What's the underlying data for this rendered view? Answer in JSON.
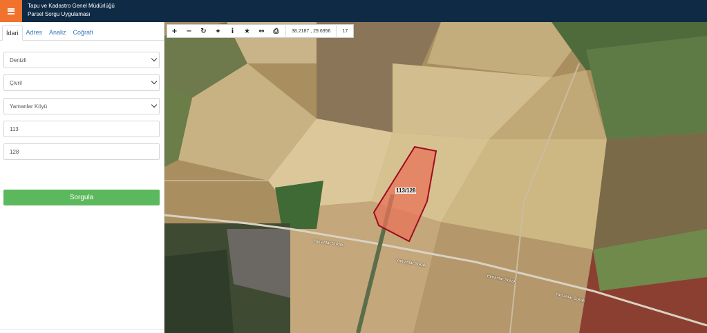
{
  "header": {
    "title_line1": "Tapu ve Kadastro Genel Müdürlüğü",
    "title_line2": "Parsel Sorgu Uygulaması",
    "menu_icon": "hamburger-icon",
    "accent": "#f0722d",
    "background": "#0f2a44"
  },
  "sidebar": {
    "tabs": [
      {
        "label": "İdari",
        "active": true
      },
      {
        "label": "Adres",
        "active": false
      },
      {
        "label": "Analiz",
        "active": false
      },
      {
        "label": "Coğrafi",
        "active": false
      }
    ],
    "province": "Denizli",
    "district": "Çivril",
    "neighborhood": "Yamanlar Köyü",
    "block": "113",
    "parcel": "128",
    "query_button": "Sorgula",
    "query_color": "#5cb85c"
  },
  "toolbar": {
    "tools": [
      "plus-icon",
      "minus-icon",
      "refresh-icon",
      "crosshair-icon",
      "info-icon",
      "star-icon",
      "measure-icon",
      "print-icon"
    ],
    "coordinates": "38.2187 , 29.6956",
    "zoom_level": "17"
  },
  "map": {
    "parcel_label": "113/128",
    "road_label_1": "Yamanlar Sokak",
    "road_label_2": "Yamanlar Sokak",
    "road_label_3": "Yamanlar Sokak",
    "road_label_4": "Yamanlar Sokak",
    "parcel_fill": "#e8735a",
    "parcel_stroke": "#9e0b1f"
  }
}
